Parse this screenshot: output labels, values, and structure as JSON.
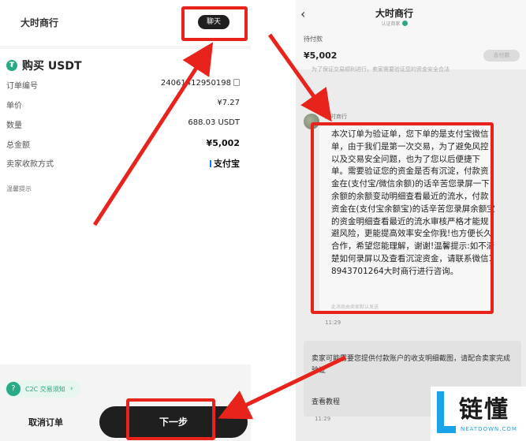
{
  "left": {
    "merchant_name": "大时商行",
    "chat_button": "聊天",
    "buy_title": "购买 USDT",
    "rows": [
      {
        "label": "订单编号",
        "value": "24061412950198"
      },
      {
        "label": "单价",
        "value": "¥7.27"
      },
      {
        "label": "数量",
        "value": "688.03 USDT"
      },
      {
        "label": "总金额",
        "value": "¥5,002"
      },
      {
        "label": "卖家收款方式",
        "value": "支付宝"
      }
    ],
    "notice_label": "温馨提示",
    "c2c_link": "C2C 交易须知",
    "cancel_button": "取消订单",
    "next_button": "下一步"
  },
  "right": {
    "title": "大时商行",
    "verified_label": "认证商家",
    "status": "待付款",
    "amount": "¥5,002",
    "pay_button": "去付款",
    "faded_notice": "为了保证交易顺利进行，卖家需要验证您的资金安全合法",
    "sender": "大时商行",
    "message": "本次订单为验证单，您下单的是支付宝微信单，由于我们是第一次交易，为了避免风控以及交易安全问题，也为了您以后便捷下单。需要验证您的资金是否有沉淀，付款资金在(支付宝/微信余额)的话辛苦您录屏一下余额的余额变动明细查看最近的流水，付款资金在(支付宝余额宝)的话辛苦您录屏余额宝的资金明细查看最近的流水审核严格才能规避风险，更能提高效率安全你我!也方便长久合作，希望您能理解，谢谢!温馨提示:如不清楚如何录屏以及查看沉淀资金，请联系微信18943701264大时商行进行咨询。",
    "auto_reply": "此消息由卖家默认发送",
    "time1": "11:29",
    "system_message": "卖家可能需要您提供付款账户的收支明细截图，请配合卖家完成验证",
    "tutorial_link": "查看教程",
    "time2": "11:29"
  },
  "watermark": {
    "brand": "链懂",
    "site": "NEATDOWN.COM"
  },
  "colors": {
    "highlight": "#e8231b",
    "accent_green": "#2aa987",
    "button_dark": "#1f1f1f"
  }
}
